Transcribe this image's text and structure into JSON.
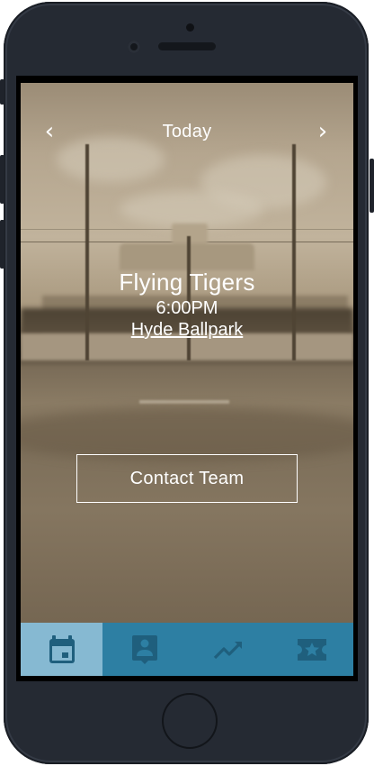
{
  "header": {
    "title": "Today",
    "prev_icon": "chevron-left-icon",
    "next_icon": "chevron-right-icon"
  },
  "game": {
    "team": "Flying Tigers",
    "time": "6:00PM",
    "venue": "Hyde Ballpark"
  },
  "actions": {
    "contact_label": "Contact Team"
  },
  "tabbar": {
    "items": [
      {
        "icon": "calendar-icon",
        "active": true
      },
      {
        "icon": "contact-card-icon",
        "active": false
      },
      {
        "icon": "stats-trend-icon",
        "active": false
      },
      {
        "icon": "ticket-star-icon",
        "active": false
      }
    ]
  },
  "colors": {
    "tabbar": "#2d7fa3",
    "tab_active": "#86b9d2",
    "icon": "#1f5f7d",
    "phone_body": "#252a33",
    "text": "#ffffff"
  }
}
